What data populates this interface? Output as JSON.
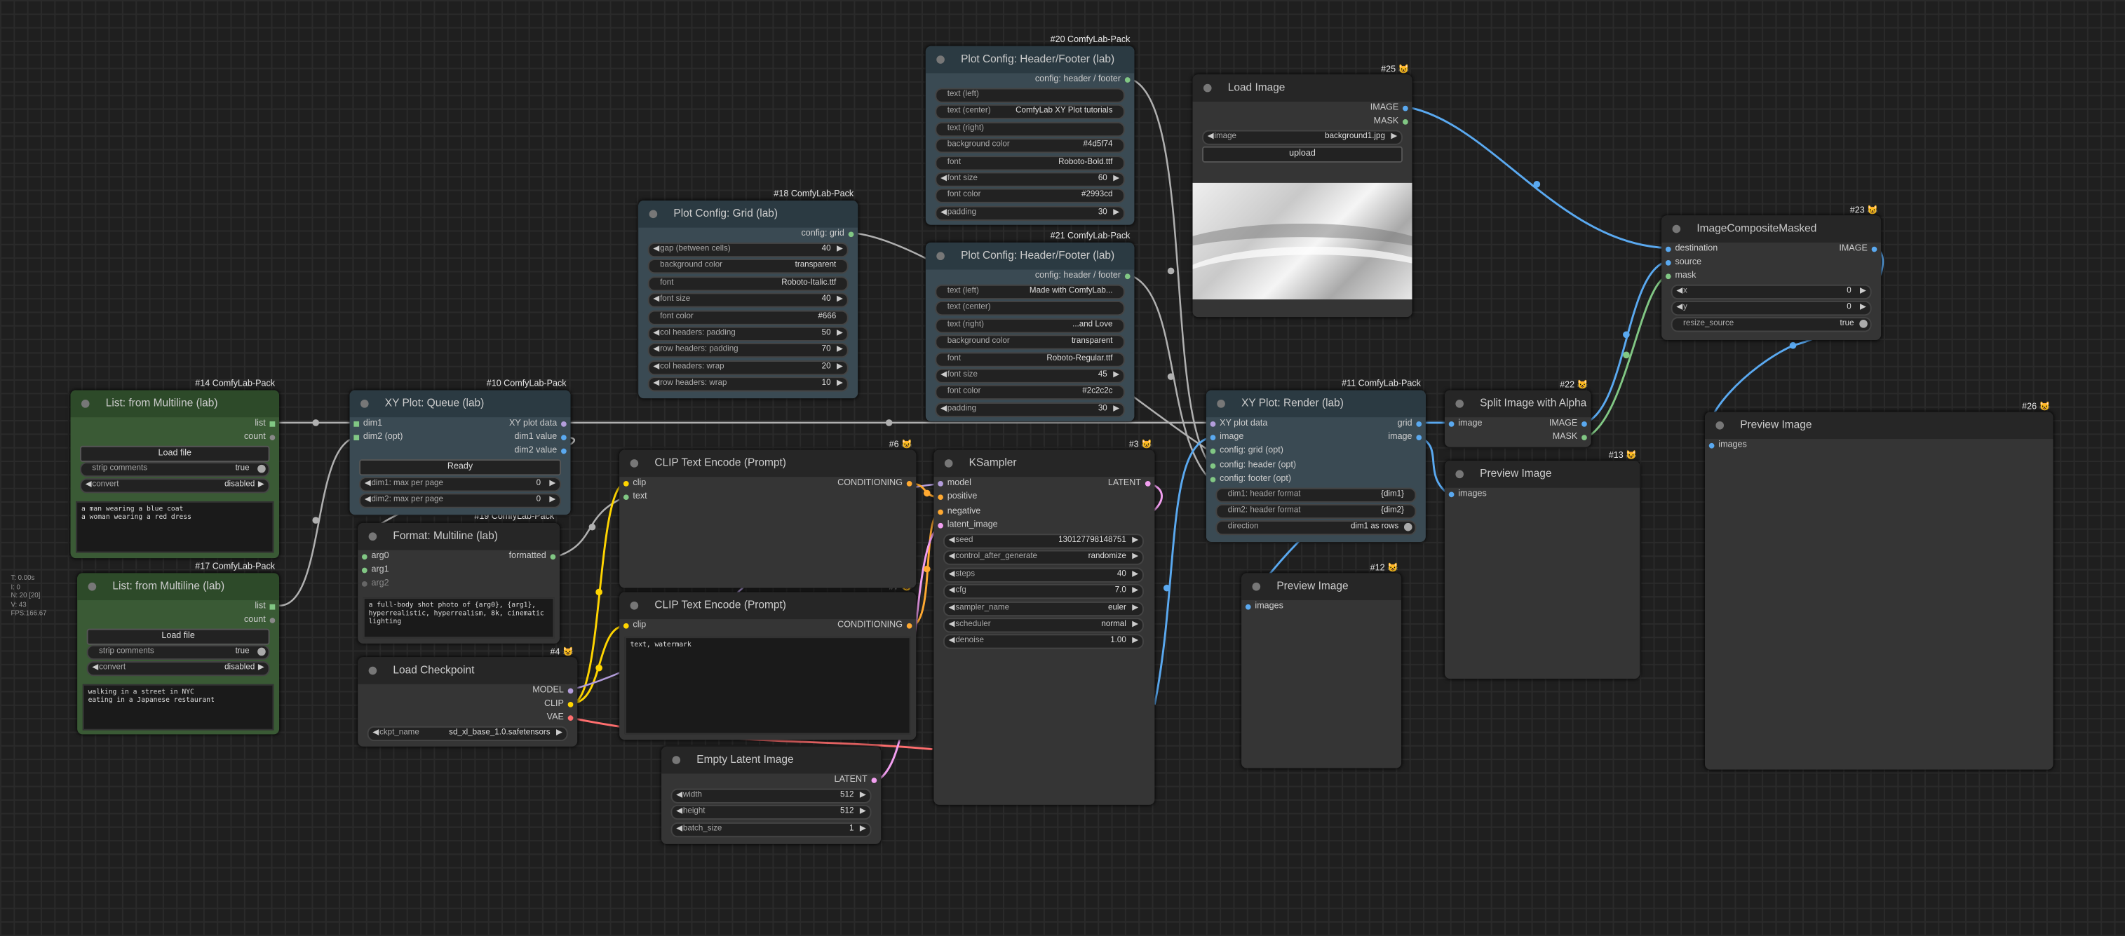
{
  "stats": {
    "t": "T: 0.00s",
    "i": "I: 0",
    "n": "N: 20 [20]",
    "v": "V: 43",
    "fps": "FPS:166.67"
  },
  "colors": {
    "image": "#5aa9f0",
    "latent": "#f29ff0",
    "clip": "#ffd500",
    "model": "#b39ddb",
    "vae": "#ff6e6e",
    "conditioning": "#ffa931",
    "mask": "#81c784",
    "generic": "#b0b0b0"
  },
  "nodes": {
    "n14": {
      "badge": "#14 ComfyLab-Pack",
      "title": "List: from Multiline (lab)",
      "out_list": "list",
      "out_count": "count",
      "load_file": "Load file",
      "strip_label": "strip comments",
      "strip_value": "true",
      "convert_label": "convert",
      "convert_value": "disabled",
      "text": "a man wearing a blue coat\na woman wearing a red dress"
    },
    "n17": {
      "badge": "#17 ComfyLab-Pack",
      "title": "List: from Multiline (lab)",
      "out_list": "list",
      "out_count": "count",
      "load_file": "Load file",
      "strip_label": "strip comments",
      "strip_value": "true",
      "convert_label": "convert",
      "convert_value": "disabled",
      "text": "walking in a street in NYC\neating in a Japanese restaurant"
    },
    "n10": {
      "badge": "#10 ComfyLab-Pack",
      "title": "XY Plot: Queue (lab)",
      "in_dim1": "dim1",
      "in_dim2": "dim2 (opt)",
      "out_data": "XY plot data",
      "out_d1": "dim1 value",
      "out_d2": "dim2 value",
      "ready": "Ready",
      "dim1_label": "dim1: max per page",
      "dim1_value": "0",
      "dim2_label": "dim2: max per page",
      "dim2_value": "0"
    },
    "n19": {
      "badge": "#19 ComfyLab-Pack",
      "title": "Format: Multiline (lab)",
      "arg0": "arg0",
      "arg1": "arg1",
      "arg2": "arg2",
      "out": "formatted",
      "text": "a full-body shot photo of {arg0}, {arg1}, hyperrealistic, hyperrealism, 8k, cinematic lighting"
    },
    "n4": {
      "badge": "#4",
      "title": "Load Checkpoint",
      "out_model": "MODEL",
      "out_clip": "CLIP",
      "out_vae": "VAE",
      "ckpt_label": "ckpt_name",
      "ckpt_value": "sd_xl_base_1.0.safetensors"
    },
    "n18": {
      "badge": "#18 ComfyLab-Pack",
      "title": "Plot Config: Grid (lab)",
      "out": "config: grid",
      "widgets": [
        {
          "label": "gap (between cells)",
          "value": "40",
          "arrows": true
        },
        {
          "label": "background color",
          "value": "transparent",
          "arrows": false
        },
        {
          "label": "font",
          "value": "Roboto-Italic.ttf",
          "arrows": false
        },
        {
          "label": "font size",
          "value": "40",
          "arrows": true
        },
        {
          "label": "font color",
          "value": "#666",
          "arrows": false
        },
        {
          "label": "col headers: padding",
          "value": "50",
          "arrows": true
        },
        {
          "label": "row headers: padding",
          "value": "70",
          "arrows": true
        },
        {
          "label": "col headers: wrap",
          "value": "20",
          "arrows": true
        },
        {
          "label": "row headers: wrap",
          "value": "10",
          "arrows": true
        }
      ]
    },
    "n20": {
      "badge": "#20 ComfyLab-Pack",
      "title": "Plot Config: Header/Footer (lab)",
      "out": "config: header / footer",
      "widgets": [
        {
          "label": "text (left)",
          "value": "",
          "arrows": false
        },
        {
          "label": "text (center)",
          "value": "ComfyLab XY Plot tutorials",
          "arrows": false
        },
        {
          "label": "text (right)",
          "value": "",
          "arrows": false
        },
        {
          "label": "background color",
          "value": "#4d5f74",
          "arrows": false
        },
        {
          "label": "font",
          "value": "Roboto-Bold.ttf",
          "arrows": false
        },
        {
          "label": "font size",
          "value": "60",
          "arrows": true
        },
        {
          "label": "font color",
          "value": "#2993cd",
          "arrows": false
        },
        {
          "label": "padding",
          "value": "30",
          "arrows": true
        }
      ]
    },
    "n21": {
      "badge": "#21 ComfyLab-Pack",
      "title": "Plot Config: Header/Footer (lab)",
      "out": "config: header / footer",
      "widgets": [
        {
          "label": "text (left)",
          "value": "Made with ComfyLab...",
          "arrows": false
        },
        {
          "label": "text (center)",
          "value": "",
          "arrows": false
        },
        {
          "label": "text (right)",
          "value": "...and Love",
          "arrows": false
        },
        {
          "label": "background color",
          "value": "transparent",
          "arrows": false
        },
        {
          "label": "font",
          "value": "Roboto-Regular.ttf",
          "arrows": false
        },
        {
          "label": "font size",
          "value": "45",
          "arrows": true
        },
        {
          "label": "font color",
          "value": "#2c2c2c",
          "arrows": false
        },
        {
          "label": "padding",
          "value": "30",
          "arrows": true
        }
      ]
    },
    "n6": {
      "badge": "#6",
      "title": "CLIP Text Encode (Prompt)",
      "in_clip": "clip",
      "in_text": "text",
      "out": "CONDITIONING"
    },
    "n7": {
      "badge": "#7",
      "title": "CLIP Text Encode (Prompt)",
      "in_clip": "clip",
      "out": "CONDITIONING",
      "text": "text, watermark"
    },
    "n5": {
      "title": "Empty Latent Image",
      "out": "LATENT",
      "widgets": [
        {
          "label": "width",
          "value": "512"
        },
        {
          "label": "height",
          "value": "512"
        },
        {
          "label": "batch_size",
          "value": "1"
        }
      ]
    },
    "n3": {
      "badge": "#3",
      "title": "KSampler",
      "in_model": "model",
      "in_pos": "positive",
      "in_neg": "negative",
      "in_latent": "latent_image",
      "out": "LATENT",
      "widgets": [
        {
          "label": "seed",
          "value": "130127798148751"
        },
        {
          "label": "control_after_generate",
          "value": "randomize"
        },
        {
          "label": "steps",
          "value": "40"
        },
        {
          "label": "cfg",
          "value": "7.0"
        },
        {
          "label": "sampler_name",
          "value": "euler"
        },
        {
          "label": "scheduler",
          "value": "normal"
        },
        {
          "label": "denoise",
          "value": "1.00"
        }
      ]
    },
    "n25": {
      "badge": "#25",
      "title": "Load Image",
      "out_image": "IMAGE",
      "out_mask": "MASK",
      "image_label": "image",
      "image_value": "background1.jpg",
      "upload": "upload"
    },
    "n11": {
      "badge": "#11 ComfyLab-Pack",
      "title": "XY Plot: Render (lab)",
      "in_data": "XY plot data",
      "in_image": "image",
      "in_grid": "config: grid (opt)",
      "in_header": "config: header (opt)",
      "in_footer": "config: footer (opt)",
      "out_grid": "grid",
      "out_image": "image",
      "w1_label": "dim1: header format",
      "w1_value": "{dim1}",
      "w2_label": "dim2: header format",
      "w2_value": "{dim2}",
      "w3_label": "direction",
      "w3_value": "dim1 as rows"
    },
    "n22": {
      "badge": "#22",
      "title": "Split Image with Alpha",
      "in_image": "image",
      "out_image": "IMAGE",
      "out_mask": "MASK"
    },
    "n23": {
      "badge": "#23",
      "title": "ImageCompositeMasked",
      "in_dest": "destination",
      "in_src": "source",
      "in_mask": "mask",
      "out": "IMAGE",
      "x_label": "x",
      "x_value": "0",
      "y_label": "y",
      "y_value": "0",
      "resize_label": "resize_source",
      "resize_value": "true"
    },
    "n13": {
      "badge": "#13",
      "title": "Preview Image",
      "in": "images"
    },
    "n12": {
      "badge": "#12",
      "title": "Preview Image",
      "in": "images"
    },
    "n26": {
      "badge": "#26",
      "title": "Preview Image",
      "in": "images"
    }
  }
}
